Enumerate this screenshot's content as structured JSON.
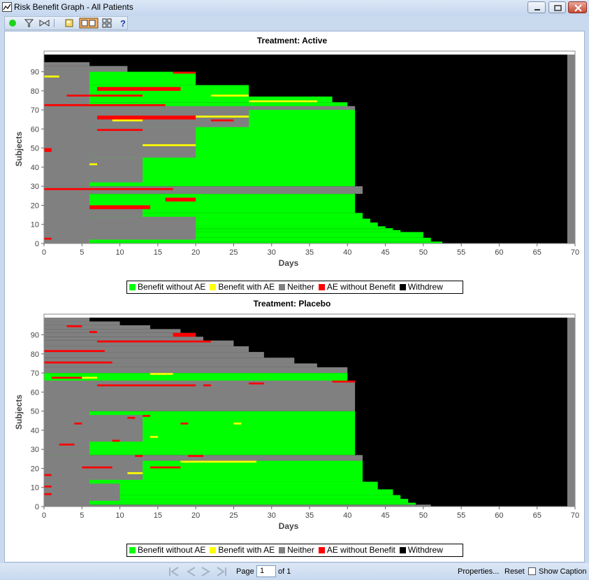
{
  "window": {
    "title": "Risk Benefit Graph - All Patients"
  },
  "colors": {
    "benefit": "#00ff00",
    "benefit_ae": "#ffff00",
    "neither": "#808080",
    "ae": "#ff0000",
    "withdrew": "#000000"
  },
  "legend": {
    "items": [
      {
        "label": "Benefit without AE",
        "color": "#00ff00"
      },
      {
        "label": "Benefit with AE",
        "color": "#ffff00"
      },
      {
        "label": "Neither",
        "color": "#808080"
      },
      {
        "label": "AE without Benefit",
        "color": "#ff0000"
      },
      {
        "label": "Withdrew",
        "color": "#000000"
      }
    ]
  },
  "pagination": {
    "page_label": "Page",
    "page_value": "1",
    "of_label": "of 1"
  },
  "footer": {
    "properties": "Properties...",
    "reset": "Reset",
    "show_caption": "Show Caption"
  },
  "chart_data": [
    {
      "type": "heatmap",
      "title": "Treatment: Active",
      "xlabel": "Days",
      "ylabel": "Subjects",
      "xlim": [
        0,
        70
      ],
      "ylim": [
        0,
        99
      ],
      "x_ticks": [
        0,
        5,
        10,
        15,
        20,
        25,
        30,
        35,
        40,
        45,
        50,
        55,
        60,
        65,
        70
      ],
      "y_ticks": [
        0,
        10,
        20,
        30,
        40,
        50,
        60,
        70,
        80,
        90
      ],
      "categories": [
        "Benefit without AE",
        "Benefit with AE",
        "Neither",
        "AE without Benefit",
        "Withdrew"
      ],
      "end_day": [
        6,
        6,
        6,
        6,
        6,
        6,
        6,
        6,
        6,
        6,
        6,
        6,
        6,
        6,
        6,
        6,
        6,
        6,
        6,
        6,
        6,
        6,
        6,
        6,
        6,
        6,
        6,
        6,
        6,
        6,
        6,
        6,
        6,
        6,
        6,
        6,
        6,
        6,
        6,
        6,
        6,
        6,
        6,
        6,
        6,
        6,
        6,
        6,
        6,
        6,
        6,
        6,
        6,
        6,
        6,
        6,
        6,
        6,
        6,
        6,
        6,
        6,
        6,
        6,
        6,
        6,
        6,
        6,
        6,
        6,
        6,
        6,
        6,
        6,
        6,
        6,
        6,
        6,
        6,
        6,
        6,
        6,
        6,
        6,
        6,
        6,
        6,
        6,
        6,
        6,
        6,
        6,
        6,
        6,
        6,
        6,
        6,
        6,
        6
      ],
      "segments": [
        {
          "y0": 0,
          "y1": 1,
          "x0": 0,
          "x1": 52.5,
          "c": "benefit"
        },
        {
          "y0": 1,
          "y1": 3,
          "x0": 0,
          "x1": 51,
          "c": "benefit"
        },
        {
          "y0": 3,
          "y1": 6,
          "x0": 0,
          "x1": 50,
          "c": "benefit"
        },
        {
          "y0": 6,
          "y1": 7,
          "x0": 0,
          "x1": 47,
          "c": "benefit"
        },
        {
          "y0": 7,
          "y1": 8,
          "x0": 0,
          "x1": 46,
          "c": "benefit"
        },
        {
          "y0": 8,
          "y1": 9,
          "x0": 0,
          "x1": 45,
          "c": "benefit"
        },
        {
          "y0": 9,
          "y1": 11,
          "x0": 0,
          "x1": 44,
          "c": "benefit"
        },
        {
          "y0": 11,
          "y1": 13,
          "x0": 0,
          "x1": 43,
          "c": "benefit"
        },
        {
          "y0": 13,
          "y1": 16,
          "x0": 0,
          "x1": 42,
          "c": "benefit"
        },
        {
          "y0": 16,
          "y1": 26,
          "x0": 0,
          "x1": 41,
          "c": "benefit"
        },
        {
          "y0": 26,
          "y1": 30,
          "x0": 0,
          "x1": 42,
          "c": "neither"
        },
        {
          "y0": 30,
          "y1": 71,
          "x0": 0,
          "x1": 41,
          "c": "benefit"
        },
        {
          "y0": 71,
          "y1": 74,
          "x0": 0,
          "x1": 40,
          "c": "benefit"
        },
        {
          "y0": 74,
          "y1": 77,
          "x0": 0,
          "x1": 38,
          "c": "benefit"
        },
        {
          "y0": 77,
          "y1": 83,
          "x0": 0,
          "x1": 27,
          "c": "benefit"
        },
        {
          "y0": 83,
          "y1": 90,
          "x0": 0,
          "x1": 20,
          "c": "benefit"
        },
        {
          "y0": 90,
          "y1": 93,
          "x0": 0,
          "x1": 11,
          "c": "neither"
        },
        {
          "y0": 93,
          "y1": 95,
          "x0": 0,
          "x1": 6,
          "c": "neither"
        },
        {
          "y0": 0,
          "y1": 30,
          "x0": 0,
          "x1": 6,
          "c": "neither"
        },
        {
          "y0": 30,
          "y1": 90,
          "x0": 0,
          "x1": 6,
          "c": "neither"
        },
        {
          "y0": 32,
          "y1": 45,
          "x0": 6,
          "x1": 13,
          "c": "neither"
        },
        {
          "y0": 45,
          "y1": 61,
          "x0": 6,
          "x1": 20,
          "c": "neither"
        },
        {
          "y0": 61,
          "y1": 70,
          "x0": 6,
          "x1": 27,
          "c": "neither"
        },
        {
          "y0": 14,
          "y1": 20,
          "x0": 6,
          "x1": 13,
          "c": "neither"
        },
        {
          "y0": 2,
          "y1": 14,
          "x0": 6,
          "x1": 20,
          "c": "neither"
        },
        {
          "y0": 70,
          "y1": 72,
          "x0": 0,
          "x1": 41,
          "c": "neither"
        },
        {
          "y0": 28,
          "y1": 29,
          "x0": 0,
          "x1": 17,
          "c": "ae"
        },
        {
          "y0": 48,
          "y1": 50,
          "x0": 0,
          "x1": 1,
          "c": "ae"
        },
        {
          "y0": 64,
          "y1": 66,
          "x0": 9,
          "x1": 13,
          "c": "benefit_ae"
        },
        {
          "y0": 65,
          "y1": 67,
          "x0": 7,
          "x1": 20,
          "c": "ae"
        },
        {
          "y0": 59,
          "y1": 60,
          "x0": 7,
          "x1": 13,
          "c": "ae"
        },
        {
          "y0": 51,
          "y1": 52,
          "x0": 13,
          "x1": 20,
          "c": "benefit_ae"
        },
        {
          "y0": 72,
          "y1": 73,
          "x0": 0,
          "x1": 16,
          "c": "ae"
        },
        {
          "y0": 80,
          "y1": 82,
          "x0": 7,
          "x1": 18,
          "c": "ae"
        },
        {
          "y0": 77,
          "y1": 78,
          "x0": 3,
          "x1": 13,
          "c": "ae"
        },
        {
          "y0": 87,
          "y1": 88,
          "x0": 0,
          "x1": 2,
          "c": "benefit_ae"
        },
        {
          "y0": 89,
          "y1": 90,
          "x0": 17,
          "x1": 20,
          "c": "ae"
        },
        {
          "y0": 66,
          "y1": 67,
          "x0": 20,
          "x1": 27,
          "c": "benefit_ae"
        },
        {
          "y0": 64,
          "y1": 65,
          "x0": 22,
          "x1": 25,
          "c": "ae"
        },
        {
          "y0": 74,
          "y1": 75,
          "x0": 27,
          "x1": 36,
          "c": "benefit_ae"
        },
        {
          "y0": 77,
          "y1": 78,
          "x0": 22,
          "x1": 27,
          "c": "benefit_ae"
        },
        {
          "y0": 22,
          "y1": 24,
          "x0": 16,
          "x1": 20,
          "c": "ae"
        },
        {
          "y0": 18,
          "y1": 20,
          "x0": 6,
          "x1": 14,
          "c": "ae"
        },
        {
          "y0": 41,
          "y1": 42,
          "x0": 6,
          "x1": 7,
          "c": "benefit_ae"
        },
        {
          "y0": 2,
          "y1": 3,
          "x0": 0,
          "x1": 1,
          "c": "ae"
        }
      ],
      "withdrew_after_day": [
        69
      ],
      "right_strip_neither": [
        69,
        70
      ]
    },
    {
      "type": "heatmap",
      "title": "Treatment: Placebo",
      "xlabel": "Days",
      "ylabel": "Subjects",
      "xlim": [
        0,
        70
      ],
      "ylim": [
        0,
        99
      ],
      "x_ticks": [
        0,
        5,
        10,
        15,
        20,
        25,
        30,
        35,
        40,
        45,
        50,
        55,
        60,
        65,
        70
      ],
      "y_ticks": [
        0,
        10,
        20,
        30,
        40,
        50,
        60,
        70,
        80,
        90
      ],
      "categories": [
        "Benefit without AE",
        "Benefit with AE",
        "Neither",
        "AE without Benefit",
        "Withdrew"
      ],
      "segments": [
        {
          "y0": 0,
          "y1": 1,
          "x0": 0,
          "x1": 51,
          "c": "neither"
        },
        {
          "y0": 1,
          "y1": 2,
          "x0": 0,
          "x1": 49,
          "c": "benefit"
        },
        {
          "y0": 2,
          "y1": 4,
          "x0": 0,
          "x1": 48,
          "c": "benefit"
        },
        {
          "y0": 4,
          "y1": 6,
          "x0": 0,
          "x1": 47,
          "c": "benefit"
        },
        {
          "y0": 6,
          "y1": 9,
          "x0": 0,
          "x1": 46,
          "c": "benefit"
        },
        {
          "y0": 9,
          "y1": 13,
          "x0": 0,
          "x1": 44,
          "c": "benefit"
        },
        {
          "y0": 13,
          "y1": 24,
          "x0": 0,
          "x1": 42,
          "c": "benefit"
        },
        {
          "y0": 24,
          "y1": 27,
          "x0": 0,
          "x1": 42,
          "c": "neither"
        },
        {
          "y0": 27,
          "y1": 50,
          "x0": 0,
          "x1": 41,
          "c": "benefit"
        },
        {
          "y0": 50,
          "y1": 66,
          "x0": 0,
          "x1": 41,
          "c": "neither"
        },
        {
          "y0": 66,
          "y1": 70,
          "x0": 0,
          "x1": 40,
          "c": "benefit"
        },
        {
          "y0": 70,
          "y1": 73,
          "x0": 0,
          "x1": 40,
          "c": "neither"
        },
        {
          "y0": 73,
          "y1": 75,
          "x0": 0,
          "x1": 36,
          "c": "neither"
        },
        {
          "y0": 75,
          "y1": 78,
          "x0": 0,
          "x1": 33,
          "c": "neither"
        },
        {
          "y0": 78,
          "y1": 81,
          "x0": 0,
          "x1": 29,
          "c": "neither"
        },
        {
          "y0": 81,
          "y1": 84,
          "x0": 0,
          "x1": 27,
          "c": "neither"
        },
        {
          "y0": 84,
          "y1": 87,
          "x0": 0,
          "x1": 25,
          "c": "neither"
        },
        {
          "y0": 87,
          "y1": 89,
          "x0": 0,
          "x1": 21,
          "c": "neither"
        },
        {
          "y0": 89,
          "y1": 91,
          "x0": 0,
          "x1": 20,
          "c": "neither"
        },
        {
          "y0": 91,
          "y1": 93,
          "x0": 0,
          "x1": 18,
          "c": "neither"
        },
        {
          "y0": 93,
          "y1": 95,
          "x0": 0,
          "x1": 14,
          "c": "neither"
        },
        {
          "y0": 95,
          "y1": 97,
          "x0": 0,
          "x1": 10,
          "c": "neither"
        },
        {
          "y0": 97,
          "y1": 99,
          "x0": 0,
          "x1": 6,
          "c": "neither"
        },
        {
          "y0": 0,
          "y1": 27,
          "x0": 0,
          "x1": 6,
          "c": "neither"
        },
        {
          "y0": 27,
          "y1": 66,
          "x0": 0,
          "x1": 6,
          "c": "neither"
        },
        {
          "y0": 34,
          "y1": 48,
          "x0": 6,
          "x1": 13,
          "c": "neither"
        },
        {
          "y0": 14,
          "y1": 25,
          "x0": 6,
          "x1": 13,
          "c": "neither"
        },
        {
          "y0": 3,
          "y1": 12,
          "x0": 6,
          "x1": 10,
          "c": "neither"
        },
        {
          "y0": 54,
          "y1": 66,
          "x0": 7,
          "x1": 20,
          "c": "neither"
        },
        {
          "y0": 63,
          "y1": 64,
          "x0": 7,
          "x1": 20,
          "c": "ae"
        },
        {
          "y0": 81,
          "y1": 82,
          "x0": 0,
          "x1": 8,
          "c": "ae"
        },
        {
          "y0": 75,
          "y1": 76,
          "x0": 0,
          "x1": 9,
          "c": "ae"
        },
        {
          "y0": 67,
          "y1": 68,
          "x0": 1,
          "x1": 5,
          "c": "ae"
        },
        {
          "y0": 67,
          "y1": 68,
          "x0": 5,
          "x1": 7,
          "c": "benefit_ae"
        },
        {
          "y0": 69,
          "y1": 70,
          "x0": 14,
          "x1": 17,
          "c": "benefit_ae"
        },
        {
          "y0": 86,
          "y1": 87,
          "x0": 7,
          "x1": 22,
          "c": "ae"
        },
        {
          "y0": 91,
          "y1": 92,
          "x0": 6,
          "x1": 7,
          "c": "ae"
        },
        {
          "y0": 94,
          "y1": 95,
          "x0": 3,
          "x1": 5,
          "c": "ae"
        },
        {
          "y0": 89,
          "y1": 91,
          "x0": 17,
          "x1": 20,
          "c": "ae"
        },
        {
          "y0": 65,
          "y1": 66,
          "x0": 38,
          "x1": 41,
          "c": "ae"
        },
        {
          "y0": 64,
          "y1": 65,
          "x0": 27,
          "x1": 29,
          "c": "ae"
        },
        {
          "y0": 63,
          "y1": 64,
          "x0": 21,
          "x1": 22,
          "c": "ae"
        },
        {
          "y0": 43,
          "y1": 44,
          "x0": 4,
          "x1": 5,
          "c": "ae"
        },
        {
          "y0": 43,
          "y1": 44,
          "x0": 18,
          "x1": 19,
          "c": "ae"
        },
        {
          "y0": 43,
          "y1": 44,
          "x0": 25,
          "x1": 26,
          "c": "benefit_ae"
        },
        {
          "y0": 46,
          "y1": 47,
          "x0": 11,
          "x1": 12,
          "c": "ae"
        },
        {
          "y0": 47,
          "y1": 48,
          "x0": 13,
          "x1": 14,
          "c": "ae"
        },
        {
          "y0": 32,
          "y1": 33,
          "x0": 2,
          "x1": 4,
          "c": "ae"
        },
        {
          "y0": 34,
          "y1": 35,
          "x0": 9,
          "x1": 10,
          "c": "ae"
        },
        {
          "y0": 36,
          "y1": 37,
          "x0": 14,
          "x1": 15,
          "c": "benefit_ae"
        },
        {
          "y0": 26,
          "y1": 27,
          "x0": 12,
          "x1": 13,
          "c": "ae"
        },
        {
          "y0": 26,
          "y1": 27,
          "x0": 19,
          "x1": 21,
          "c": "ae"
        },
        {
          "y0": 23,
          "y1": 24,
          "x0": 18,
          "x1": 21,
          "c": "benefit_ae"
        },
        {
          "y0": 23,
          "y1": 24,
          "x0": 21,
          "x1": 28,
          "c": "benefit_ae"
        },
        {
          "y0": 20,
          "y1": 21,
          "x0": 5,
          "x1": 9,
          "c": "ae"
        },
        {
          "y0": 20,
          "y1": 21,
          "x0": 14,
          "x1": 18,
          "c": "ae"
        },
        {
          "y0": 17,
          "y1": 18,
          "x0": 11,
          "x1": 13,
          "c": "benefit_ae"
        },
        {
          "y0": 16,
          "y1": 17,
          "x0": 0,
          "x1": 1,
          "c": "ae"
        },
        {
          "y0": 10,
          "y1": 11,
          "x0": 0,
          "x1": 1,
          "c": "ae"
        },
        {
          "y0": 6,
          "y1": 7,
          "x0": 0,
          "x1": 1,
          "c": "ae"
        }
      ],
      "withdrew_after_day": [
        69
      ],
      "right_strip_neither": [
        69,
        70
      ]
    }
  ]
}
